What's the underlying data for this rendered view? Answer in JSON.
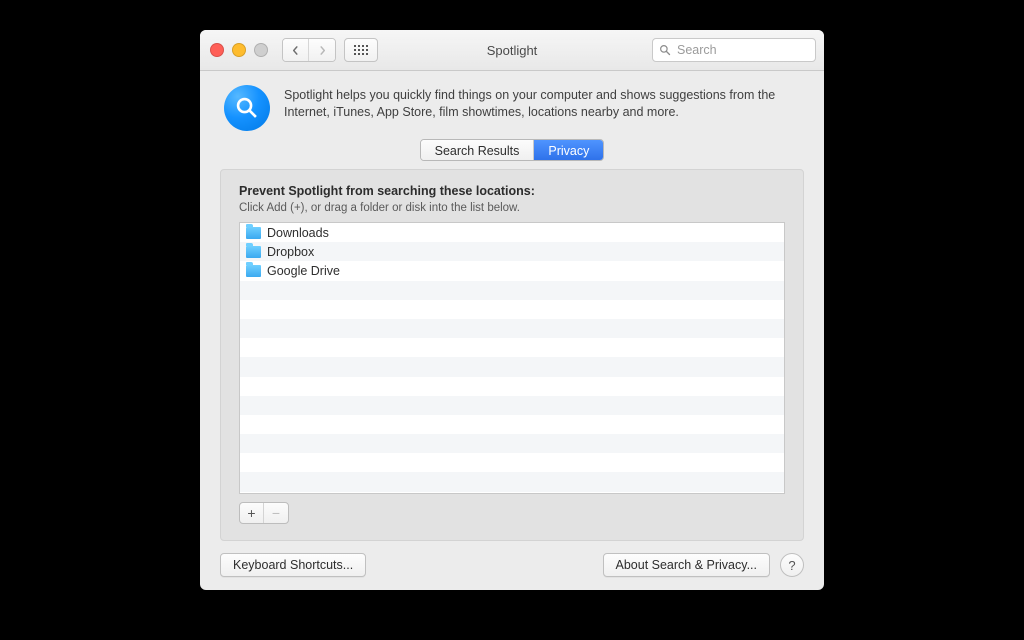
{
  "window": {
    "title": "Spotlight",
    "search_placeholder": "Search"
  },
  "header": {
    "description": "Spotlight helps you quickly find things on your computer and shows suggestions from the Internet, iTunes, App Store, film showtimes, locations nearby and more."
  },
  "tabs": {
    "search_results": "Search Results",
    "privacy": "Privacy"
  },
  "panel": {
    "heading": "Prevent Spotlight from searching these locations:",
    "hint": "Click Add (+), or drag a folder or disk into the list below.",
    "items": [
      {
        "label": "Downloads"
      },
      {
        "label": "Dropbox"
      },
      {
        "label": "Google Drive"
      }
    ],
    "add_label": "+",
    "remove_label": "−"
  },
  "footer": {
    "keyboard_shortcuts": "Keyboard Shortcuts...",
    "about": "About Search & Privacy...",
    "help": "?"
  }
}
